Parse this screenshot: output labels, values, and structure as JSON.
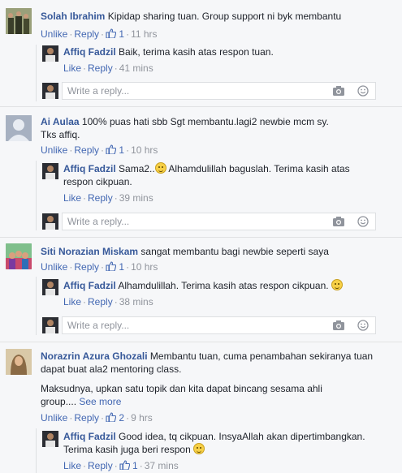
{
  "reply_placeholder": "Write a reply...",
  "comments": [
    {
      "author": "Solah Ibrahim",
      "text": "Kipidap sharing tuan. Group support ni byk membantu",
      "actions": {
        "unlike": "Unlike",
        "reply": "Reply",
        "likes": "1",
        "time": "11 hrs"
      },
      "reply": {
        "author": "Affiq Fadzil",
        "text": "Baik, terima kasih atas respon tuan.",
        "actions": {
          "like": "Like",
          "reply": "Reply",
          "time": "41 mins"
        }
      }
    },
    {
      "author": "Ai Aulaa",
      "text_line1": "100% puas hati sbb Sgt membantu.lagi2 newbie mcm sy.",
      "text_line2": "Tks affiq.",
      "actions": {
        "unlike": "Unlike",
        "reply": "Reply",
        "likes": "1",
        "time": "10 hrs"
      },
      "reply": {
        "author": "Affiq Fadzil",
        "text_a": "Sama2..",
        "text_b": " Alhamdulillah baguslah. Terima kasih atas",
        "text_line2": "respon cikpuan.",
        "actions": {
          "like": "Like",
          "reply": "Reply",
          "time": "39 mins"
        }
      }
    },
    {
      "author": "Siti Norazian Miskam",
      "text": "sangat membantu bagi newbie seperti saya",
      "actions": {
        "unlike": "Unlike",
        "reply": "Reply",
        "likes": "1",
        "time": "10 hrs"
      },
      "reply": {
        "author": "Affiq Fadzil",
        "text": "Alhamdulillah. Terima kasih atas respon cikpuan.",
        "actions": {
          "like": "Like",
          "reply": "Reply",
          "time": "38 mins"
        }
      }
    },
    {
      "author": "Norazrin Azura Ghozali",
      "text": "Membantu tuan, cuma penambahan sekiranya tuan",
      "text_line2": "dapat buat ala2 mentoring class.",
      "text_line3": "Maksudnya, upkan satu topik dan kita dapat bincang sesama ahli",
      "text_line4": "group....",
      "see_more": "See more",
      "actions": {
        "unlike": "Unlike",
        "reply": "Reply",
        "likes": "2",
        "time": "9 hrs"
      },
      "reply": {
        "author": "Affiq Fadzil",
        "text": "Good idea, tq cikpuan. InsyaAllah akan dipertimbangkan.",
        "text_line2": "Terima kasih juga beri respon",
        "actions": {
          "like": "Like",
          "reply": "Reply",
          "likes": "1",
          "time": "37 mins"
        }
      }
    }
  ],
  "colors": {
    "link": "#4267b2",
    "name": "#365899",
    "meta": "#90949c",
    "background": "#f6f7f9"
  }
}
